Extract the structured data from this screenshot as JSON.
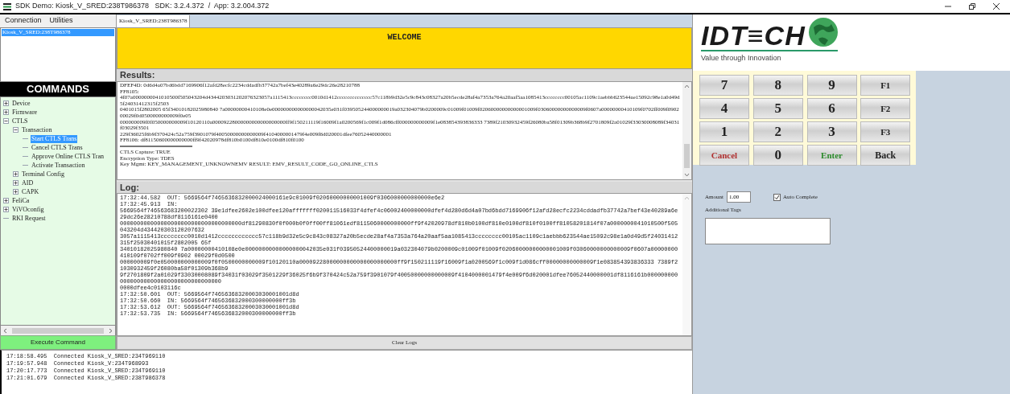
{
  "window": {
    "title": "SDK Demo: Kiosk_V_SRED:238T986378   SDK: 3.2.4.372  /  App: 3.2.004.372"
  },
  "menu": [
    "Connection",
    "Utilities"
  ],
  "devices": [
    {
      "label": "Kiosk_V_SRED:238T986378",
      "selected": true
    }
  ],
  "commands": {
    "title": "COMMANDS",
    "tree": [
      {
        "label": "Device",
        "expanded": false,
        "selected": false
      },
      {
        "label": "Firmware",
        "expanded": false,
        "selected": false
      },
      {
        "label": "CTLS",
        "expanded": true,
        "selected": false,
        "children": [
          {
            "label": "Transaction",
            "expanded": true,
            "selected": false,
            "children": [
              {
                "label": "Start CTLS Trans",
                "selected": true
              },
              {
                "label": "Cancel CTLS Trans",
                "selected": false
              },
              {
                "label": "Approve Online CTLS Tran",
                "selected": false
              },
              {
                "label": "Activate Transaction",
                "selected": false
              }
            ]
          },
          {
            "label": "Terminal Config",
            "expanded": false,
            "selected": false
          },
          {
            "label": "AID",
            "expanded": false,
            "selected": false
          },
          {
            "label": "CAPK",
            "expanded": false,
            "selected": false
          }
        ]
      },
      {
        "label": "FeliCa",
        "expanded": false,
        "selected": false
      },
      {
        "label": "ViVOconfig",
        "expanded": false,
        "selected": false
      },
      {
        "label": "RKI Request",
        "selected": false
      }
    ]
  },
  "execute_button": "Execute Command",
  "tab": {
    "label": "Kiosk_V_SRED:238T986378"
  },
  "display": "WELCOME",
  "results": {
    "title": "Results:",
    "data_lines": [
      "DFEF4D: 0d6d4a07bd6bdd7169906f12afd28ecfc2234cddadfb37742a7bef43e40289a6e29dc26e28210788",
      "FF8105:",
      "4f07a0000000041010500f505043204d4344203031202076323057a1115413cccccccc0010d1412cccccccccccccc57c118b9d32e5c9c843c08327a20b5ecde28af4a7353a764a20aaf5aa1085413cccccccc00105ac1109c1aebbb623544ae15092c98e1a0d49d5f24031412315f2503",
      "0401015f2802005 65f34010182025980840 7a00000000410108e0e000000000000000042035e031f039505244000000019a032304079b0200009c01009f01009f02060000000000001009f03060000000000009f0607a00000000410109f0702ff009f0902 00029f0d0500000000009f0e05",
      "000000009f0f050000000009f10120110a00009228000000000000000000ff9f150211119f16009f1a0200569f1c009f1d086cff000000000009f1e083854393836333 7389f21030932459f26080ba58f01309b368b9f2701809f2a01029f33030008089f34031f03029f3501",
      "229f36025f6b9f370424c52a759f3901079f40050000000000009f4104000001479f4e009f6d020001dfee76052440000001",
      "FF8106: df81150600000000000ff9f42020978df810b0100df810e0100df810f0100"
    ],
    "summary_lines": [
      "CTLS Capture: TRUE",
      "Encryption Type: TDES",
      "Key Mgmt: KEY_MANAGEMENT_UNKNOWNEMV RESULT: EMV_RESULT_CODE_GO_ONLINE_CTLS"
    ]
  },
  "log": {
    "title": "Log:",
    "lines": [
      "17:32:44.582  OUT: 5669564f7465636832000024000161e9c01009f02060000000001009f0306000000000000e6e2",
      "17:32:45.913  IN:",
      "5669564f746563683200022302 39e1dfee2602e100dfee120afffffff020011516033f4dfef4c06002400000000dfef4d280d6d4a07bd6bdd7169906f12afd28ecfc2234cddadfb37742a7bef43e40289a6e29dc26e28210788df8116161e0400",
      "000000000000000000000000000000000000df81290830f0f000b0f0ff00ff81061edf8115060000000000ff9f42020978df810b0100df810e0100df810f0100ff81058201814f07a0000000041010500f505043204d434420303120207632",
      "3057a1115413cccccccc0010d1412cccccccccccc57c118b9d32e5c9c843c08327a20b5ecde28af4a7353a764a20aaf5aa1085413cccccccc00105ac1109c1aebbb623544ae15092c98e1a0d49d5f24031412315f25030401015f2802005 65f",
      "34010182025980840 7a00000000410108e0e00000000000000000042035e031f03950524400000019a032304079b0200009c01009f01009f02060000000000001009f03060000000000009f0607a00000000410109f0702ff009f0902 00029f0d0500",
      "000000009f0e050000000000009f0f0500000000009f10120110a00009228000000000000000000000ff9f150211119f16009f1a0200569f1c009f1d086cff00000000000009f1e083854393836333 7389f21030932459f26080ba58f01309b368b9",
      "9f2701809f2a01029f33030008089f34031f03029f3501229f36025f6b9f370424c52a759f3901079f40050000000000009f4104000001479f4e009f6d020001dfee76052440000001df8116161b000000000000000000000000000000000000000",
      "0000dfee4c0103116c",
      "17:32:50.601  OUT: 5669564f74656368320003030001001d8d",
      "17:32:50.660  IN: 5669564f7465636832000300000000ff3b",
      "17:32:53.612  OUT: 5669564f74656368320003030001001d8d",
      "17:32:53.735  IN: 5669564f7465636832000300000000ff3b"
    ]
  },
  "clear_button": "Clear Logs",
  "console": [
    "17:18:58.495  Connected Kiosk_V_SRED:234T969110",
    "17:19:57.948  Connected Kiosk_V:234T968993",
    "17:20:17.773  Connected Kiosk_V_SRED:234T969110",
    "17:21:01.679  Connected Kiosk_V_SRED:238T986378"
  ],
  "logo": {
    "text": "IDT≡CH",
    "tagline": "Value through Innovation"
  },
  "keypad": [
    {
      "label": "7",
      "kind": "digit"
    },
    {
      "label": "8",
      "kind": "digit"
    },
    {
      "label": "9",
      "kind": "digit"
    },
    {
      "label": "F1",
      "kind": "function"
    },
    {
      "label": "4",
      "kind": "digit"
    },
    {
      "label": "5",
      "kind": "digit"
    },
    {
      "label": "6",
      "kind": "digit"
    },
    {
      "label": "F2",
      "kind": "function"
    },
    {
      "label": "1",
      "kind": "digit"
    },
    {
      "label": "2",
      "kind": "digit"
    },
    {
      "label": "3",
      "kind": "digit"
    },
    {
      "label": "F3",
      "kind": "function"
    },
    {
      "label": "Cancel",
      "kind": "cancel"
    },
    {
      "label": "0",
      "kind": "digit"
    },
    {
      "label": "Enter",
      "kind": "enter"
    },
    {
      "label": "Back",
      "kind": "back"
    }
  ],
  "amount": {
    "label": "Amount",
    "value": "1.00"
  },
  "auto_complete": {
    "label": "Auto Complete",
    "checked": true
  },
  "additional_tags": {
    "label": "Additional Tags"
  }
}
